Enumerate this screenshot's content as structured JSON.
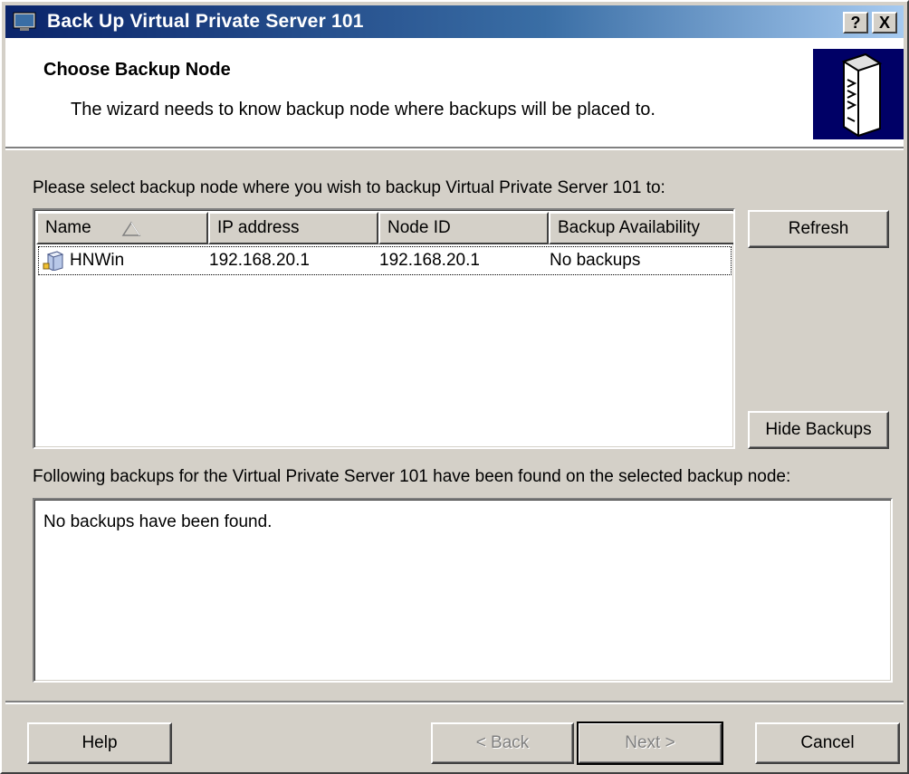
{
  "window": {
    "title": "Back Up Virtual Private Server 101",
    "help_label": "?",
    "close_label": "X"
  },
  "header": {
    "title": "Choose Backup Node",
    "subtitle": "The wizard needs to know backup node where backups will be placed to."
  },
  "nodes_section": {
    "label": "Please select backup node where you wish to backup Virtual Private Server 101 to:",
    "columns": [
      "Name",
      "IP address",
      "Node ID",
      "Backup Availability"
    ],
    "sort_column": "Name",
    "rows": [
      {
        "name": "HNWin",
        "ip": "192.168.20.1",
        "node_id": "192.168.20.1",
        "availability": "No backups"
      }
    ]
  },
  "backups_section": {
    "label": "Following backups for the Virtual Private Server 101 have been found on the selected backup node:",
    "message": "No backups have been found."
  },
  "buttons": {
    "refresh": "Refresh",
    "hide_backups": "Hide Backups",
    "help": "Help",
    "back": "< Back",
    "next": "Next >",
    "cancel": "Cancel"
  },
  "colors": {
    "titlebar_start": "#0a246a",
    "titlebar_end": "#a6caf0",
    "dialog_face": "#d4d0c8",
    "header_graphic_bg": "#000066"
  },
  "icons": {
    "title": "server-window-icon",
    "header": "server-tower-icon",
    "row": "server-node-icon",
    "sort": "sort-ascending-icon"
  }
}
